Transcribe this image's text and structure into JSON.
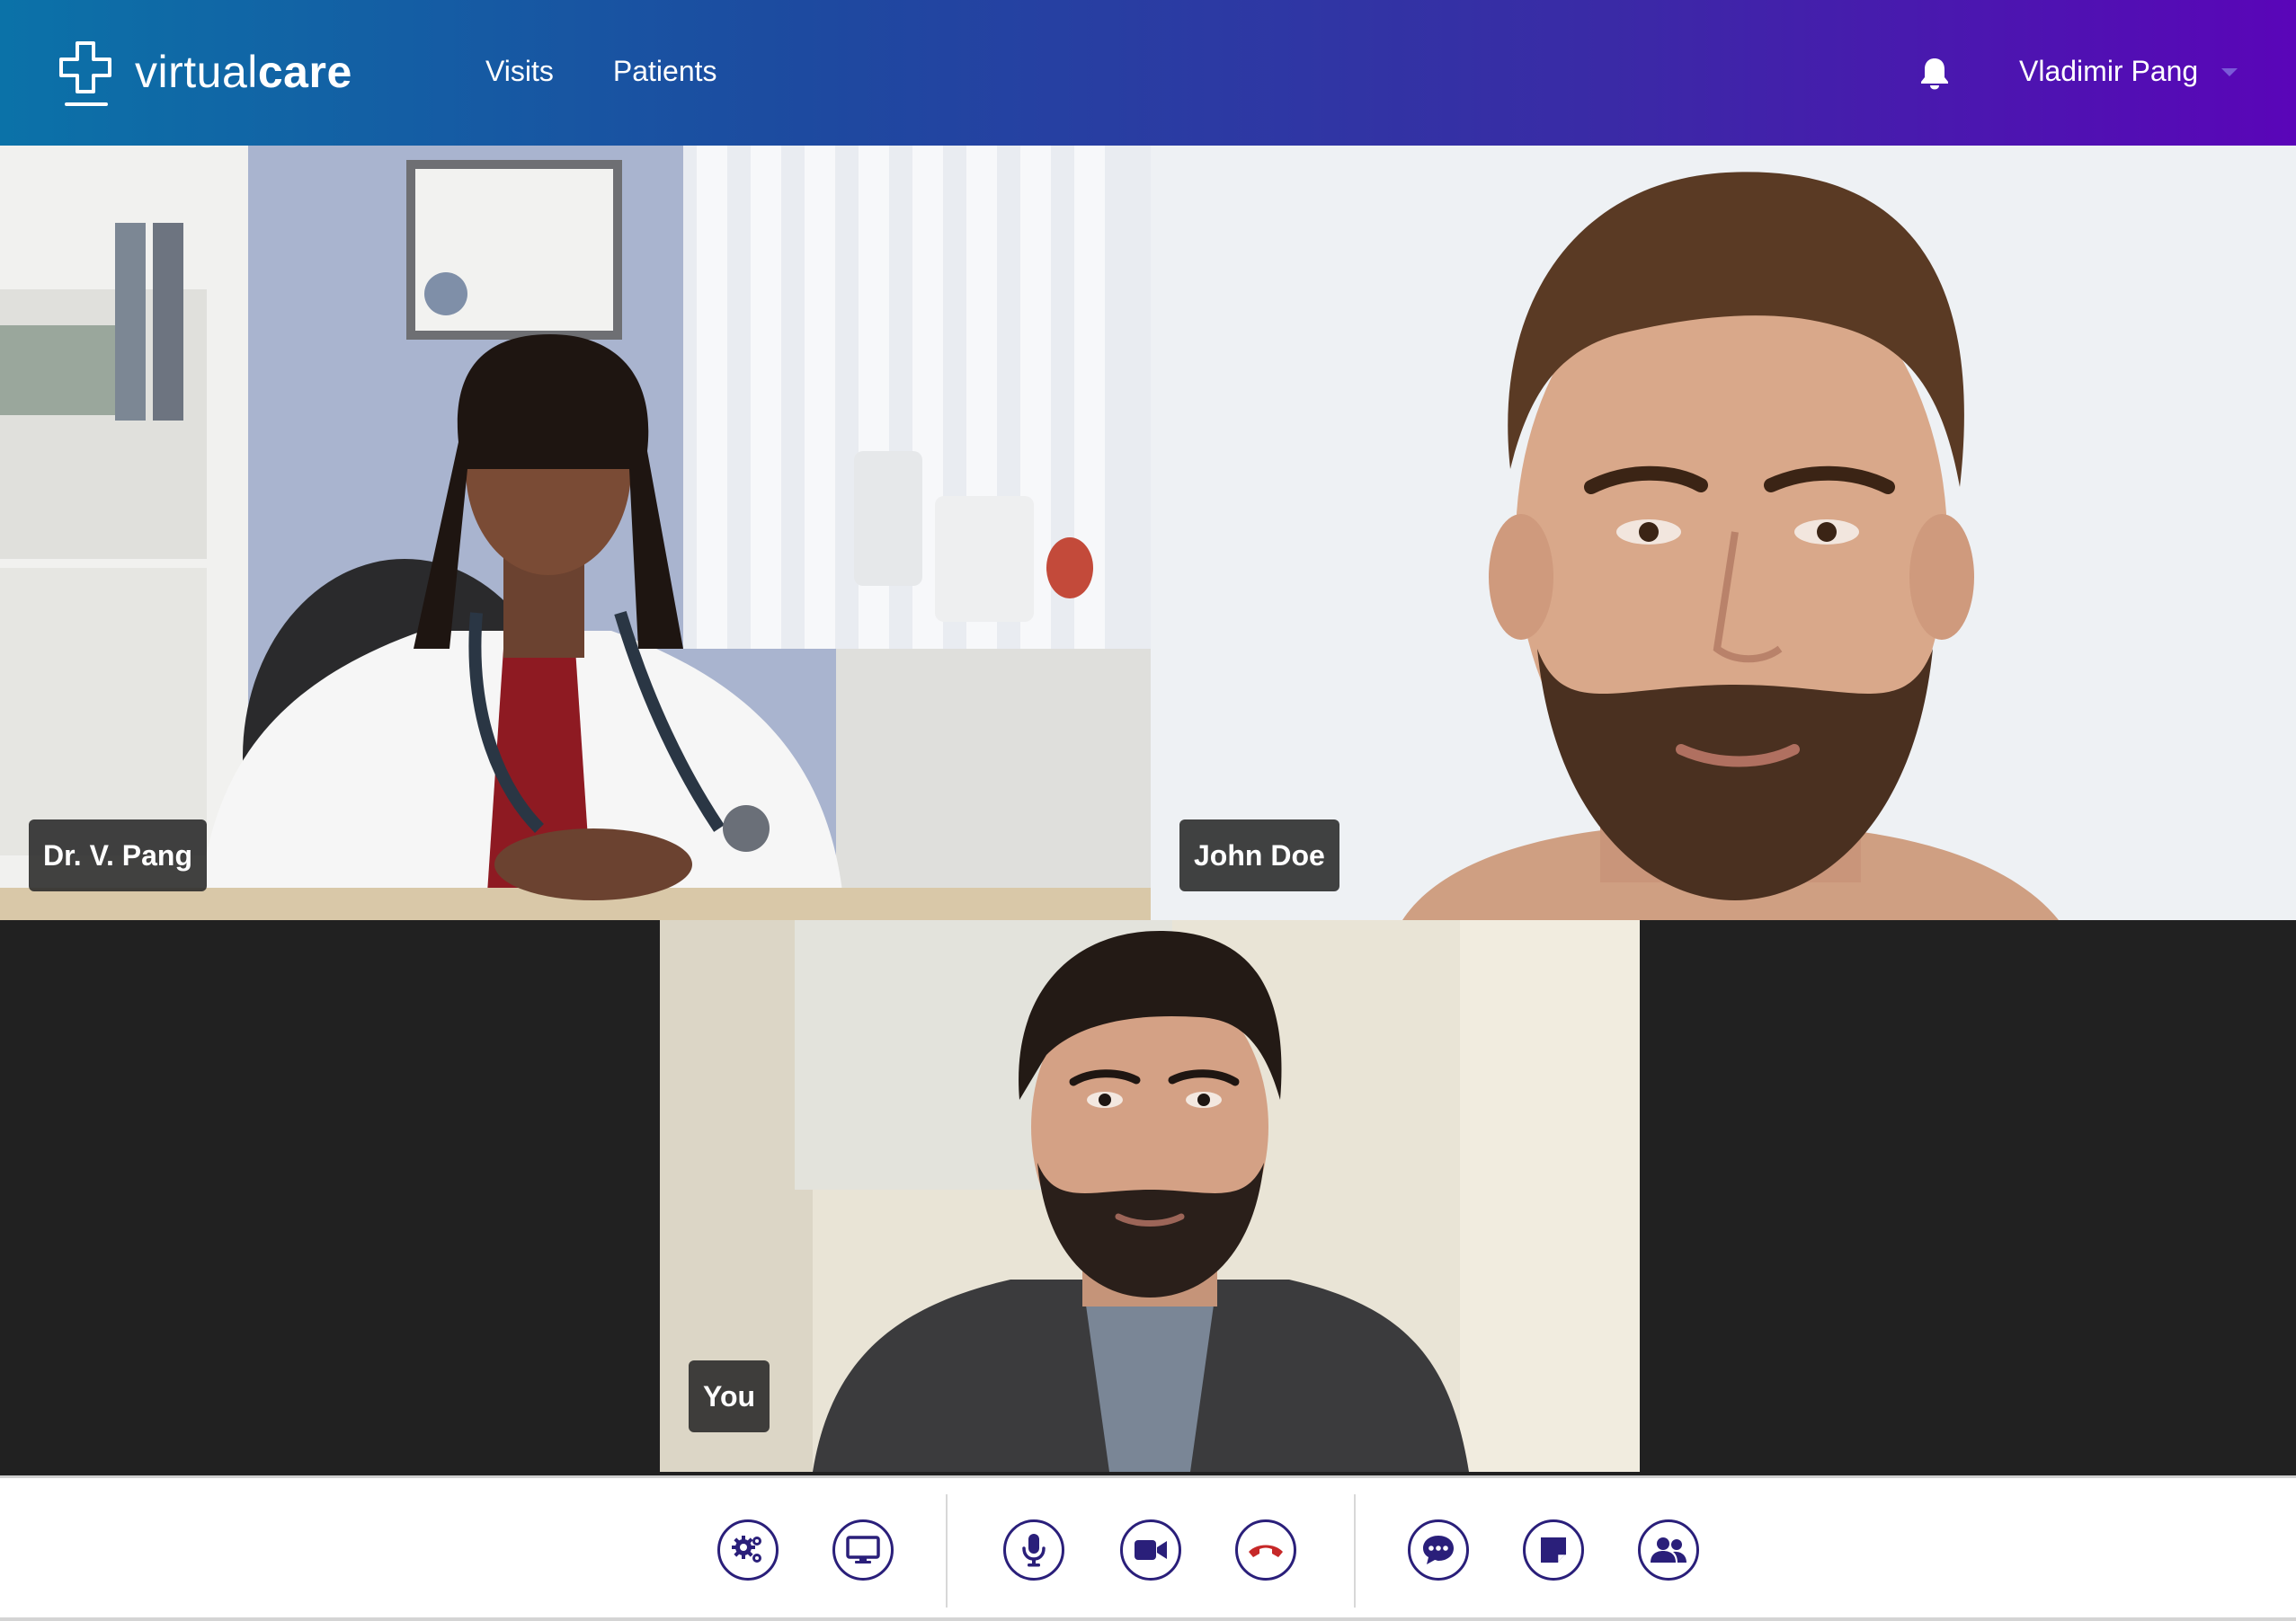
{
  "brand": {
    "name_light": "virtual",
    "name_bold": "care",
    "gradient_start": "#0b72a8",
    "gradient_end": "#5a05b8"
  },
  "nav": {
    "items": [
      {
        "label": "Visits"
      },
      {
        "label": "Patients"
      }
    ]
  },
  "header": {
    "notification_icon": "bell-icon",
    "user_name": "Vladimir Pang"
  },
  "participants": [
    {
      "label": "Dr. V. Pang",
      "role": "doctor"
    },
    {
      "label": "John Doe",
      "role": "patient"
    },
    {
      "label": "You",
      "role": "self"
    }
  ],
  "controls": {
    "accent": "#2a1f7a",
    "end_call_color": "#c62828",
    "groups": [
      [
        "settings-icon",
        "screen-share-icon"
      ],
      [
        "microphone-icon",
        "camera-icon",
        "end-call-icon"
      ],
      [
        "chat-icon",
        "notes-icon",
        "participants-icon"
      ]
    ]
  }
}
